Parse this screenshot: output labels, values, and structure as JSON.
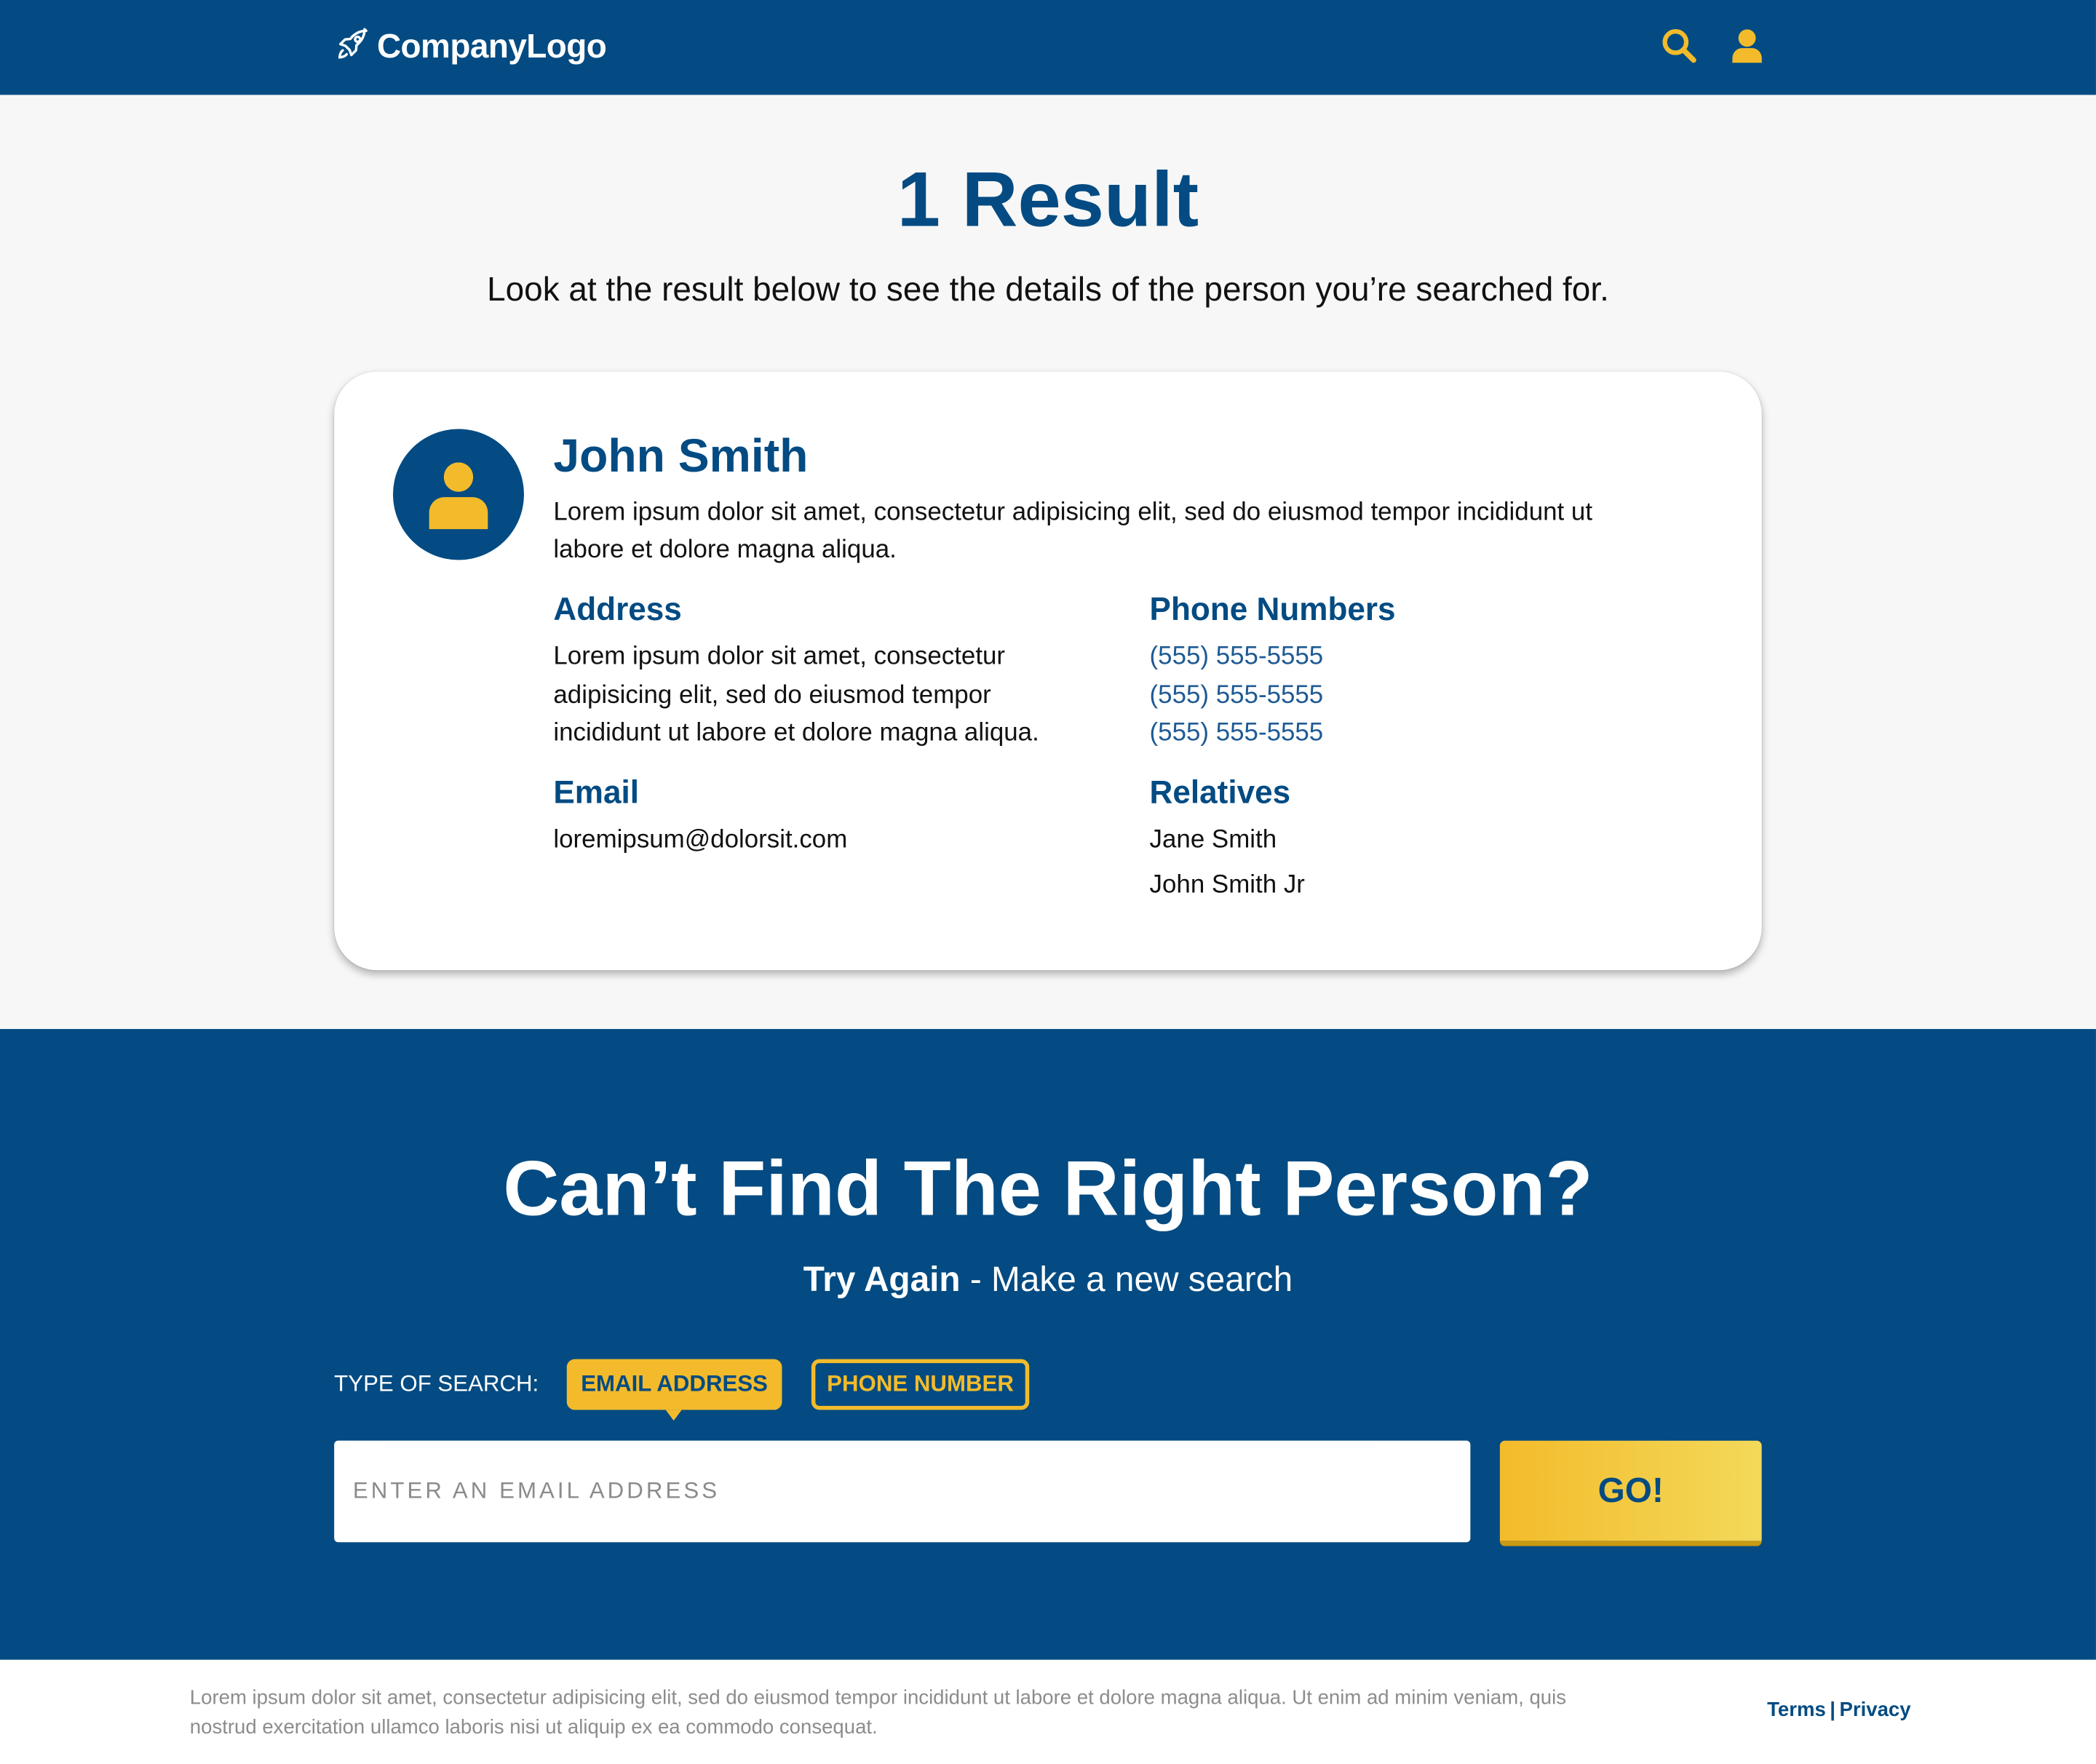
{
  "colors": {
    "brand_blue": "#034b82",
    "accent_yellow": "#f3bb2b",
    "background": "#f7f7f7",
    "white": "#ffffff"
  },
  "header": {
    "logo_text": "CompanyLogo",
    "logo_icon": "rocket-icon",
    "search_icon": "search-icon",
    "user_icon": "user-icon"
  },
  "results": {
    "title": "1 Result",
    "subtitle": "Look at the result below to see the details of the person you’re searched for."
  },
  "person": {
    "name": "John Smith",
    "description": "Lorem ipsum dolor sit amet, consectetur adipisicing elit, sed do eiusmod tempor incididunt ut labore et dolore magna aliqua.",
    "avatar_icon": "user-avatar-icon",
    "address_title": "Address",
    "address_lines": [
      "Lorem ipsum dolor sit amet, consectetur",
      "adipisicing elit, sed do eiusmod tempor",
      "incididunt ut labore et dolore magna aliqua."
    ],
    "phones_title": "Phone Numbers",
    "phones": [
      "(555) 555-5555",
      "(555) 555-5555",
      "(555) 555-5555"
    ],
    "email_title": "Email",
    "email": "loremipsum@dolorsit.com",
    "relatives_title": "Relatives",
    "relatives": [
      "Jane Smith",
      "John Smith Jr"
    ]
  },
  "search": {
    "title": "Can’t Find The Right Person?",
    "sub_bold": "Try Again",
    "sub_rest": " - Make a new search",
    "type_label": "TYPE OF SEARCH:",
    "type_options": [
      "EMAIL ADDRESS",
      "PHONE NUMBER"
    ],
    "selected_type": "EMAIL ADDRESS",
    "input_placeholder": "ENTER AN EMAIL ADDRESS",
    "input_value": "",
    "go_label": "GO!"
  },
  "footer": {
    "text": "Lorem ipsum dolor sit amet, consectetur adipisicing elit, sed do eiusmod tempor incididunt ut labore et dolore magna aliqua. Ut enim ad minim veniam, quis nostrud exercitation ullamco laboris nisi ut aliquip ex ea commodo consequat.",
    "terms_label": "Terms",
    "separator": "|",
    "privacy_label": "Privacy"
  }
}
